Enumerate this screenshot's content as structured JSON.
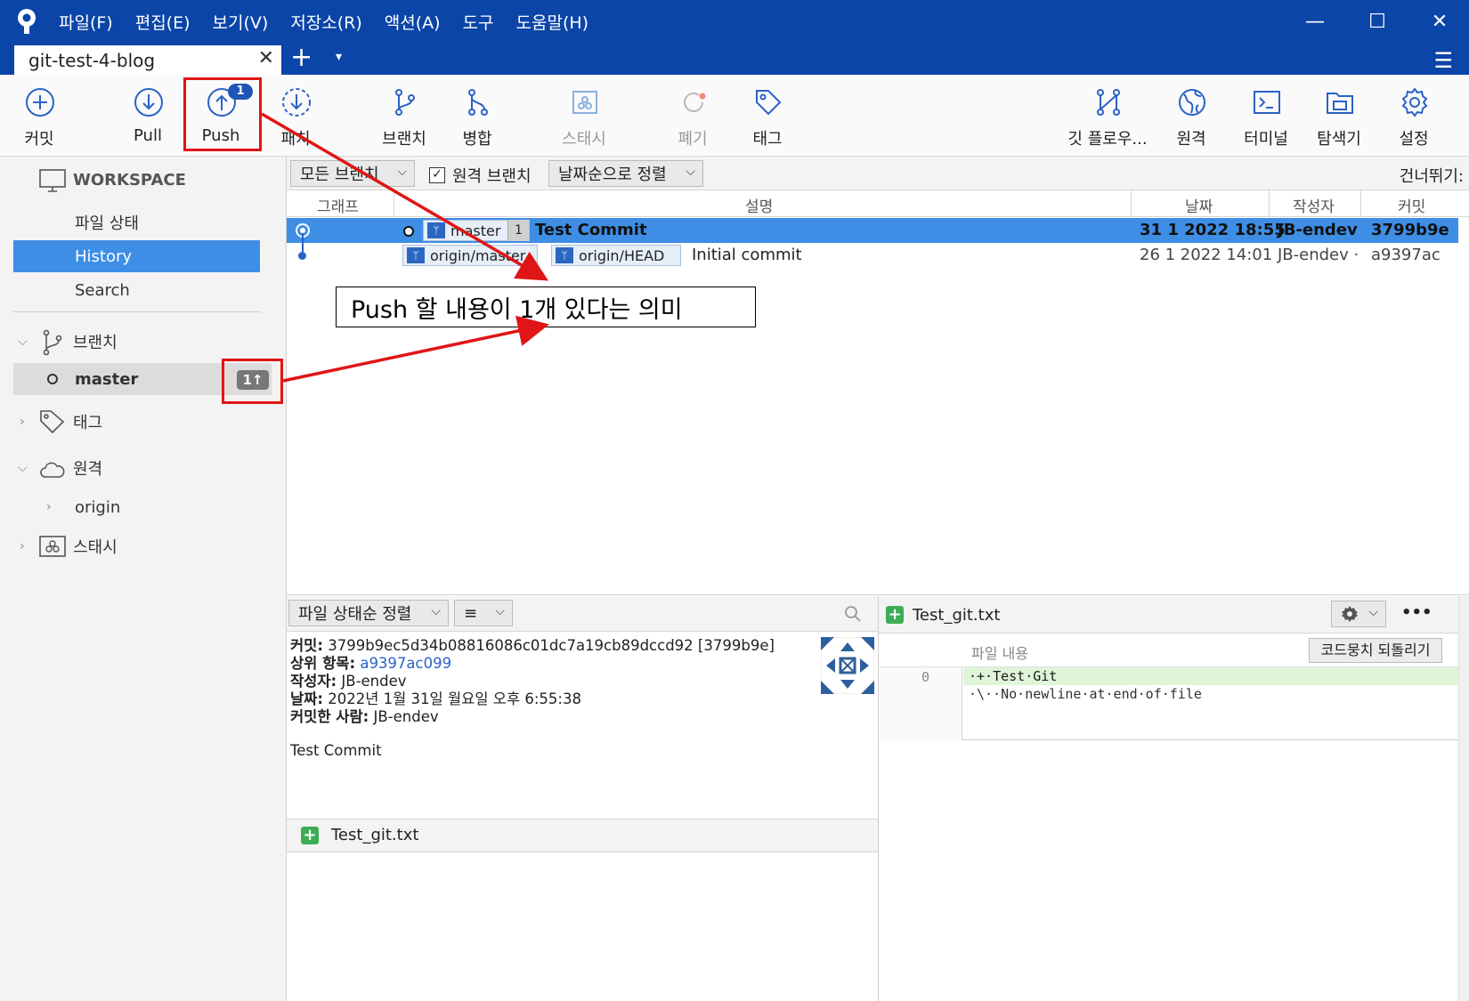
{
  "menu": {
    "items": [
      "파일(F)",
      "편집(E)",
      "보기(V)",
      "저장소(R)",
      "액션(A)",
      "도구",
      "도움말(H)"
    ],
    "minimize": "—",
    "maximize": "☐",
    "close": "✕"
  },
  "tabs": {
    "repo_name": "git-test-4-blog",
    "close": "✕",
    "add": "+",
    "dropdown": "▾",
    "menu": "☰"
  },
  "toolbar": {
    "commit": "커밋",
    "pull": "Pull",
    "push": "Push",
    "push_badge": "1",
    "fetch": "패치",
    "branch": "브랜치",
    "merge": "병합",
    "stash": "스태시",
    "discard": "폐기",
    "tag": "태그",
    "git_flow": "깃 플로우...",
    "remote": "원격",
    "terminal": "터미널",
    "explorer": "탐색기",
    "settings": "설정"
  },
  "sidebar": {
    "workspace": "WORKSPACE",
    "items": [
      "파일 상태",
      "History",
      "Search"
    ],
    "branches_title": "브랜치",
    "branch_name": "master",
    "branch_badge": "1↑",
    "tags_title": "태그",
    "remotes_title": "원격",
    "remote_name": "origin",
    "stash_title": "스태시"
  },
  "filter": {
    "branches": "모든 브랜치",
    "remote_branches": "원격 브랜치",
    "sort": "날짜순으로 정렬",
    "jump": "건너뛰기:"
  },
  "columns": {
    "graph": "그래프",
    "description": "설명",
    "date": "날짜",
    "author": "작성자",
    "commit": "커밋"
  },
  "commits": [
    {
      "ref": "master",
      "ref_count": "1",
      "message": "Test Commit",
      "date": "31 1 2022 18:55",
      "author": "JB-endev",
      "hash": "3799b9e"
    },
    {
      "ref1": "origin/master",
      "ref2": "origin/HEAD",
      "message": "Initial commit",
      "date": "26 1 2022 14:01",
      "author": "JB-endev ·",
      "hash": "a9397ac"
    }
  ],
  "detail": {
    "sort": "파일 상태순 정렬",
    "view": "≡",
    "commit_label": "커밋:",
    "commit_value": "3799b9ec5d34b08816086c01dc7a19cb89dccd92 [3799b9e]",
    "parent_label": "상위 항목:",
    "parent_value": "a9397ac099",
    "author_label": "작성자:",
    "author_value": "JB-endev",
    "date_label": "날짜:",
    "date_value": "2022년 1월 31일 월요일 오후 6:55:38",
    "committer_label": "커밋한 사람:",
    "committer_value": "JB-endev",
    "message": "Test Commit",
    "file": "Test_git.txt"
  },
  "diff": {
    "file": "Test_git.txt",
    "content_label": "파일 내용",
    "revert": "코드뭉치 되돌리기",
    "line_no": "0",
    "added_line": "·+·Test·Git",
    "note_line": "·\\··No·newline·at·end·of·file",
    "more": "•••"
  },
  "annotation": {
    "callout": "Push 할 내용이 1개 있다는 의미",
    "color": "#e01515"
  }
}
